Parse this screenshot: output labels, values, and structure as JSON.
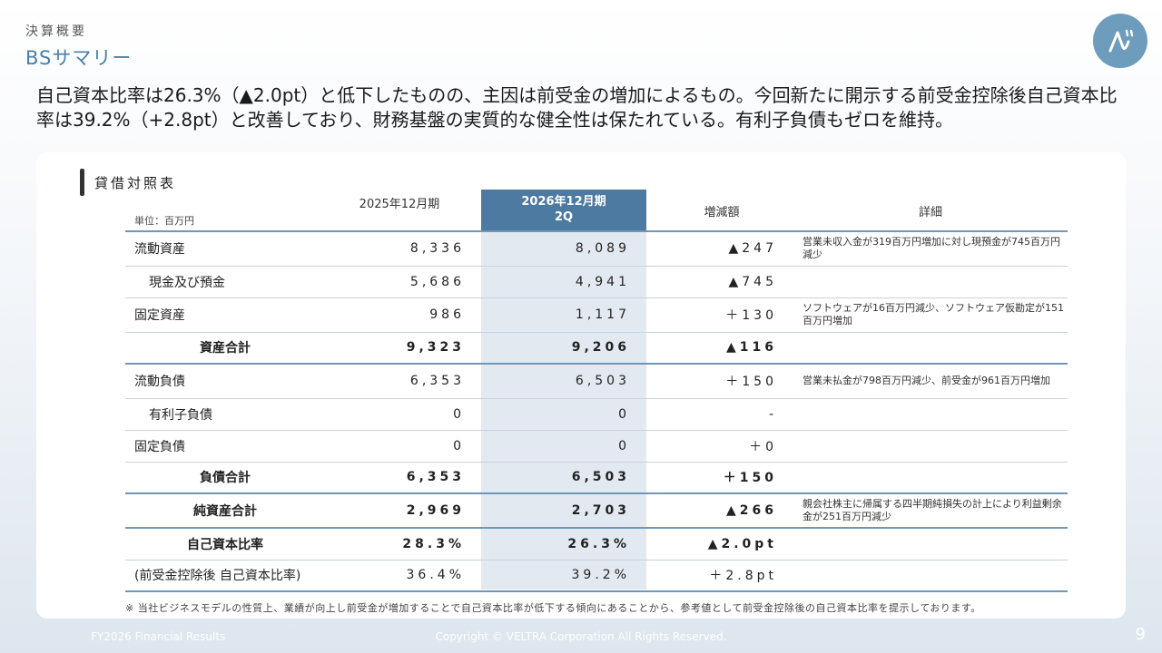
{
  "header": {
    "section": "決算概要",
    "title": "BSサマリー"
  },
  "headline": "自己資本比率は26.3%（▲2.0pt）と低下したものの、主因は前受金の増加によるもの。今回新たに開示する前受金控除後自己資本比率は39.2%（+2.8pt）と改善しており、財務基盤の実質的な健全性は保たれている。有利子負債もゼロを維持。",
  "card": {
    "title": "貸借対照表",
    "unit": "単位：百万円",
    "columns": {
      "prev": "2025年12月期",
      "curr_line1": "2026年12月期",
      "curr_line2": "2Q",
      "diff": "増減額",
      "detail": "詳細"
    },
    "rows": [
      {
        "label": "流動資産",
        "prev": "8,336",
        "curr": "8,089",
        "diff": "▲247",
        "detail": "営業未収入金が319百万円増加に対し現預金が745百万円減少"
      },
      {
        "label": "現金及び預金",
        "prev": "5,686",
        "curr": "4,941",
        "diff": "▲745",
        "detail": ""
      },
      {
        "label": "固定資産",
        "prev": "986",
        "curr": "1,117",
        "diff": "＋130",
        "detail": "ソフトウェアが16百万円減少、ソフトウェア仮勘定が151百万円増加"
      },
      {
        "label": "資産合計",
        "prev": "9,323",
        "curr": "9,206",
        "diff": "▲116",
        "detail": ""
      },
      {
        "label": "流動負債",
        "prev": "6,353",
        "curr": "6,503",
        "diff": "＋150",
        "detail": "営業未払金が798百万円減少、前受金が961百万円増加"
      },
      {
        "label": "有利子負債",
        "prev": "0",
        "curr": "0",
        "diff": "-",
        "detail": ""
      },
      {
        "label": "固定負債",
        "prev": "0",
        "curr": "0",
        "diff": "＋0",
        "detail": ""
      },
      {
        "label": "負債合計",
        "prev": "6,353",
        "curr": "6,503",
        "diff": "＋150",
        "detail": ""
      },
      {
        "label": "純資産合計",
        "prev": "2,969",
        "curr": "2,703",
        "diff": "▲266",
        "detail": "親会社株主に帰属する四半期純損失の計上により利益剰余金が251百万円減少"
      },
      {
        "label": "自己資本比率",
        "prev": "28.3%",
        "curr": "26.3%",
        "diff": "▲2.0pt",
        "detail": ""
      },
      {
        "label": "(前受金控除後 自己資本比率)",
        "prev": "36.4%",
        "curr": "39.2%",
        "diff": "＋2.8pt",
        "detail": ""
      }
    ],
    "note": "※ 当社ビジネスモデルの性質上、業績が向上し前受金が増加することで自己資本比率が低下する傾向にあることから、参考値として前受金控除後の自己資本比率を提示しております。"
  },
  "footer": {
    "left": "FY2026 Financial Results",
    "center": "Copyright © VELTRA Corporation All Rights Reserved.",
    "page": "9"
  },
  "colors": {
    "accent": "#4d7aa0",
    "title": "#4a7fa8",
    "logo": "#6e9cbc"
  }
}
